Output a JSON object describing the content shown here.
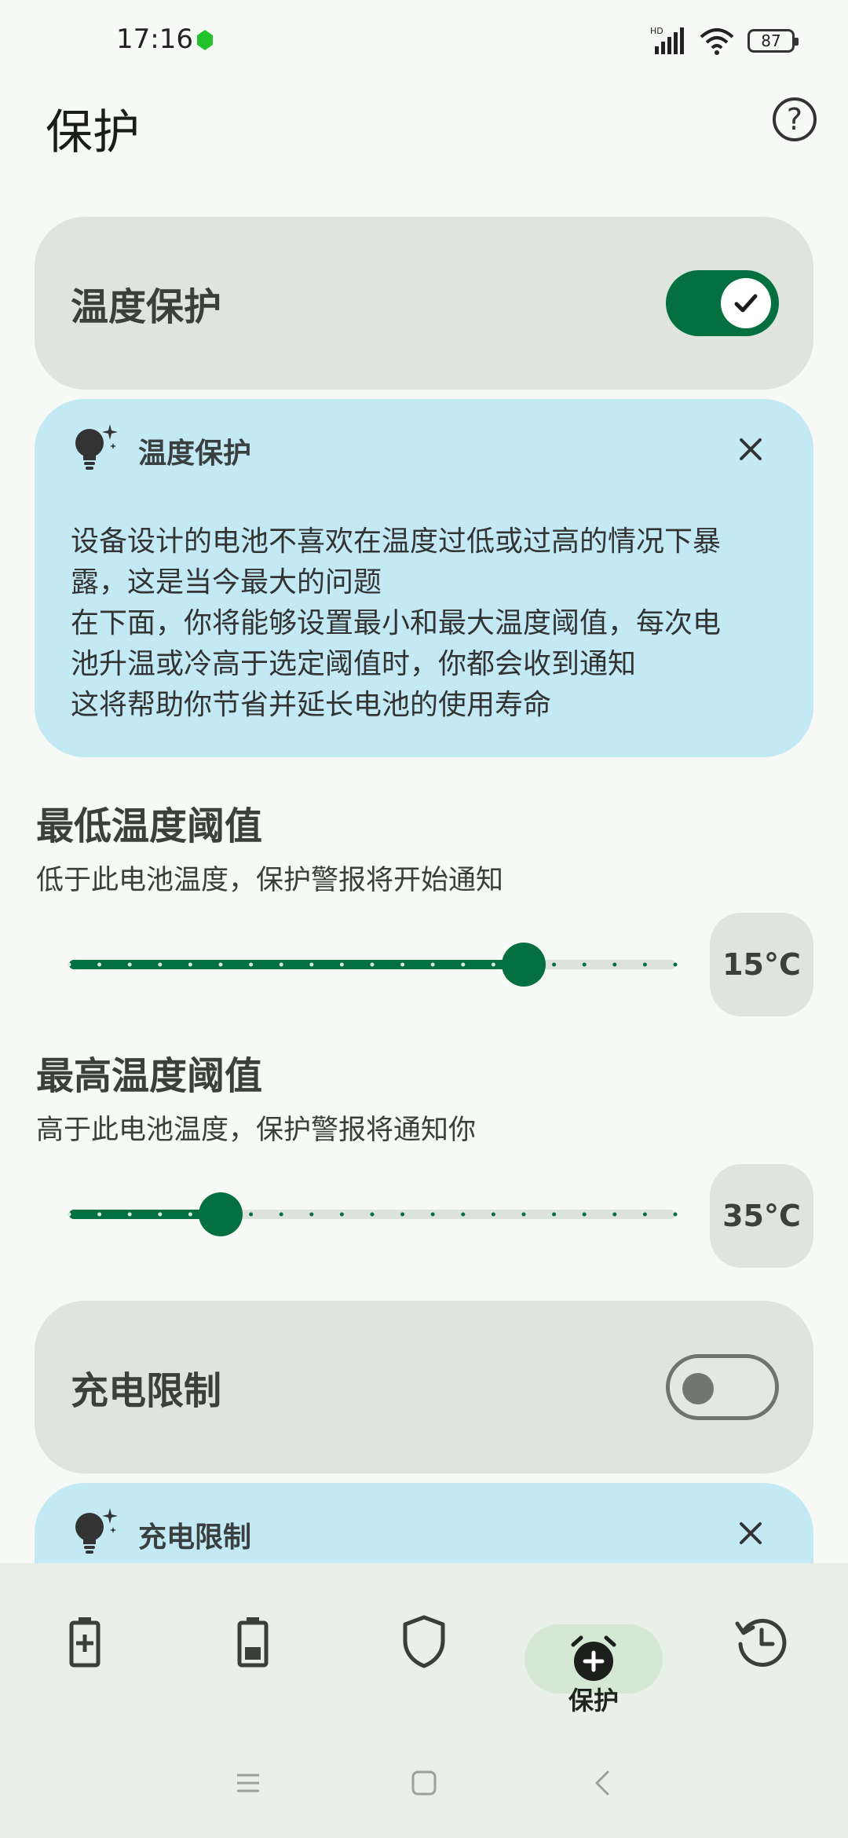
{
  "status_bar": {
    "time": "17:16",
    "network": "HD",
    "battery": "87",
    "icons": [
      "app-notification-dot-icon",
      "signal-icon",
      "wifi-icon",
      "battery-icon"
    ]
  },
  "header": {
    "title": "保护",
    "help_icon": "help-circle-icon"
  },
  "temperature_protection": {
    "label": "温度保护",
    "enabled": true
  },
  "temperature_info": {
    "title": "温度保护",
    "lines": [
      "设备设计的电池不喜欢在温度过低或过高的情况下暴",
      "露，这是当今最大的问题",
      "在下面，你将能够设置最小和最大温度阈值，每次电",
      "池升温或冷高于选定阈值时，你都会收到通知",
      "这将帮助你节省并延长电池的使用寿命"
    ]
  },
  "min_threshold": {
    "title": "最低温度阈值",
    "subtitle": "低于此电池温度，保护警报将开始通知",
    "value_label": "15°C",
    "fraction": 0.75
  },
  "max_threshold": {
    "title": "最高温度阈值",
    "subtitle": "高于此电池温度，保护警报将通知你",
    "value_label": "35°C",
    "fraction": 0.25
  },
  "charge_limit": {
    "label": "充电限制",
    "enabled": false
  },
  "charge_info": {
    "title": "充电限制"
  },
  "bottom_nav": {
    "items": [
      {
        "icon": "battery-charging-icon",
        "label": ""
      },
      {
        "icon": "battery-icon",
        "label": ""
      },
      {
        "icon": "shield-icon",
        "label": ""
      },
      {
        "icon": "alarm-add-icon",
        "label": "保护",
        "active": true
      },
      {
        "icon": "history-icon",
        "label": ""
      }
    ]
  },
  "colors": {
    "accent": "#04703f",
    "card": "#dfe5de",
    "info": "#c2e9f4",
    "background": "#f7f9f6"
  }
}
